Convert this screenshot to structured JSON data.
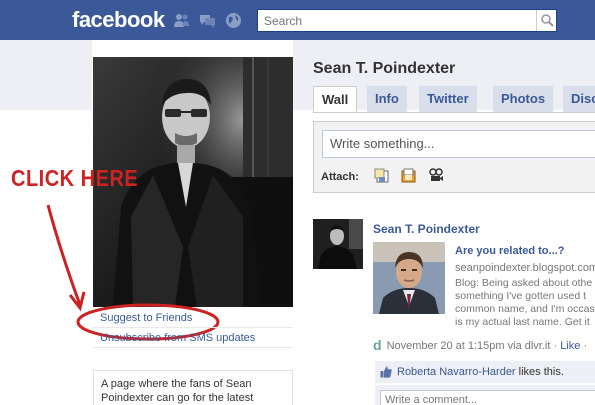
{
  "header": {
    "logo": "facebook",
    "search_placeholder": "Search",
    "icons": [
      "friends-icon",
      "messages-icon",
      "notifications-globe-icon",
      "search-magnifier-icon"
    ],
    "brand_color": "#3b5998"
  },
  "annotation": {
    "text": "CLICK HERE",
    "color": "#cc2222"
  },
  "sidebar": {
    "links": [
      {
        "label": "Suggest to Friends"
      },
      {
        "label": "Unsubscribe from SMS updates"
      }
    ],
    "info": "A page where the fans of Sean Poindexter can go for the latest"
  },
  "profile": {
    "name": "Sean T. Poindexter",
    "tabs": [
      "Wall",
      "Info",
      "Twitter",
      "Photos",
      "Disc"
    ],
    "active_tab": "Wall"
  },
  "composer": {
    "placeholder": "Write something...",
    "attach_label": "Attach:",
    "attach_icons": [
      "photo-attach-icon",
      "link-attach-icon",
      "video-attach-icon"
    ]
  },
  "story": {
    "author": "Sean T. Poindexter",
    "title": "Are you related to...?",
    "url": "seanpoindexter.blogspot.com",
    "description_lines": [
      "Blog: Being asked about othe",
      "something I've gotten used t",
      "common name, and I'm occas",
      "is my actual last name. Get it"
    ],
    "meta_time": "November 20 at 1:15pm via dlvr.it",
    "meta_sep": " · ",
    "meta_like": "Like",
    "meta_trailing": " · ",
    "source_icon": "d",
    "liker": "Roberta Navarro-Harder",
    "likes_suffix": " likes this.",
    "comment_placeholder": "Write a comment..."
  }
}
